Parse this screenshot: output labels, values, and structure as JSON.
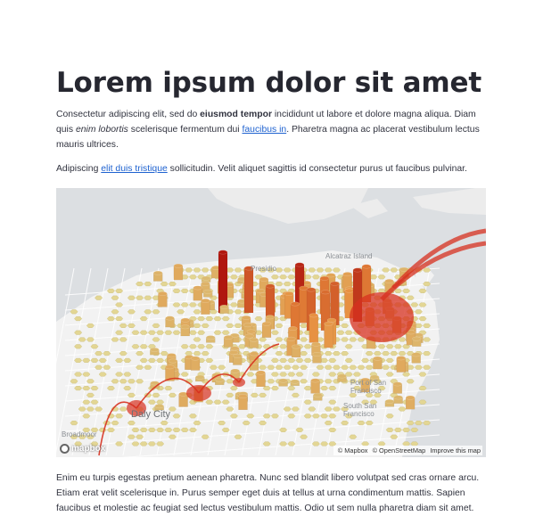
{
  "page": {
    "title": "Lorem ipsum dolor sit amet",
    "para1": {
      "t1": "Consectetur adipiscing elit, sed do ",
      "bold": "eiusmod tempor",
      "t2": " incididunt ut labore et dolore magna aliqua. Diam quis ",
      "italic": "enim lobortis",
      "t3": " scelerisque fermentum dui ",
      "link": "faucibus in",
      "t4": ". Pharetra magna ac placerat vestibulum lectus mauris ultrices."
    },
    "para2": {
      "t1": "Adipiscing ",
      "link": "elit duis tristique",
      "t2": " sollicitudin. Velit aliquet sagittis id consectetur purus ut faucibus pulvinar."
    },
    "para3": "Enim eu turpis egestas pretium aenean pharetra. Nunc sed blandit libero volutpat sed cras ornare arcu. Etiam erat velit scelerisque in. Purus semper eget duis at tellus at urna condimentum mattis. Sapien faucibus et molestie ac feugiat sed lectus vestibulum mattis. Odio ut sem nulla pharetra diam sit amet."
  },
  "map": {
    "logo": "mapbox",
    "attribution": {
      "mapbox": "© Mapbox",
      "osm": "© OpenStreetMap",
      "improve": "Improve this map"
    },
    "labels": {
      "presidio": "Presidio",
      "alcatraz": "Alcatraz Island",
      "daly_city": "Daly City",
      "broadmoor": "Broadmoor",
      "port_sf": "Port of San Francisco",
      "south_sf": "South San Francisco"
    },
    "colors": {
      "water": "#dcdfe2",
      "land": "#f2f2f2",
      "hex": "#e3d694",
      "column_low": "#d9c27a",
      "column_high": "#b0170f",
      "arc": "#d7301f"
    }
  }
}
